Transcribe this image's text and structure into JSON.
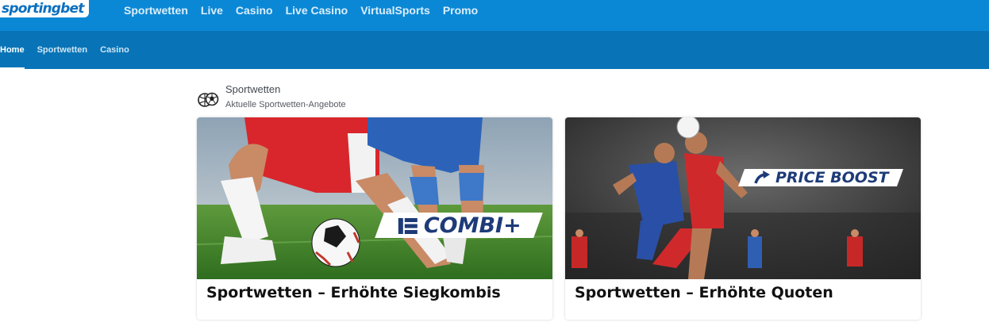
{
  "brand": {
    "logo_text": "sportingbet"
  },
  "top_nav": {
    "items": [
      {
        "label": "Sportwetten"
      },
      {
        "label": "Live"
      },
      {
        "label": "Casino"
      },
      {
        "label": "Live Casino"
      },
      {
        "label": "VirtualSports"
      },
      {
        "label": "Promo"
      }
    ]
  },
  "sub_nav": {
    "items": [
      {
        "label": "Home",
        "active": true
      },
      {
        "label": "Sportwetten",
        "active": false
      },
      {
        "label": "Casino",
        "active": false
      }
    ]
  },
  "section": {
    "icon": "sports-balls-icon",
    "title": "Sportwetten",
    "subtitle": "Aktuelle Sportwetten-Angebote"
  },
  "cards": [
    {
      "badge": "COMBI+",
      "badge_icon": "combi-icon",
      "caption": "Sportwetten – Erhöhte Siegkombis"
    },
    {
      "badge": "PRICE BOOST",
      "badge_icon": "boost-arrow-icon",
      "caption": "Sportwetten – Erhöhte Quoten"
    }
  ],
  "colors": {
    "topbar": "#0b88d5",
    "subbar": "#0874b7",
    "badge_text": "#1e3b78"
  }
}
